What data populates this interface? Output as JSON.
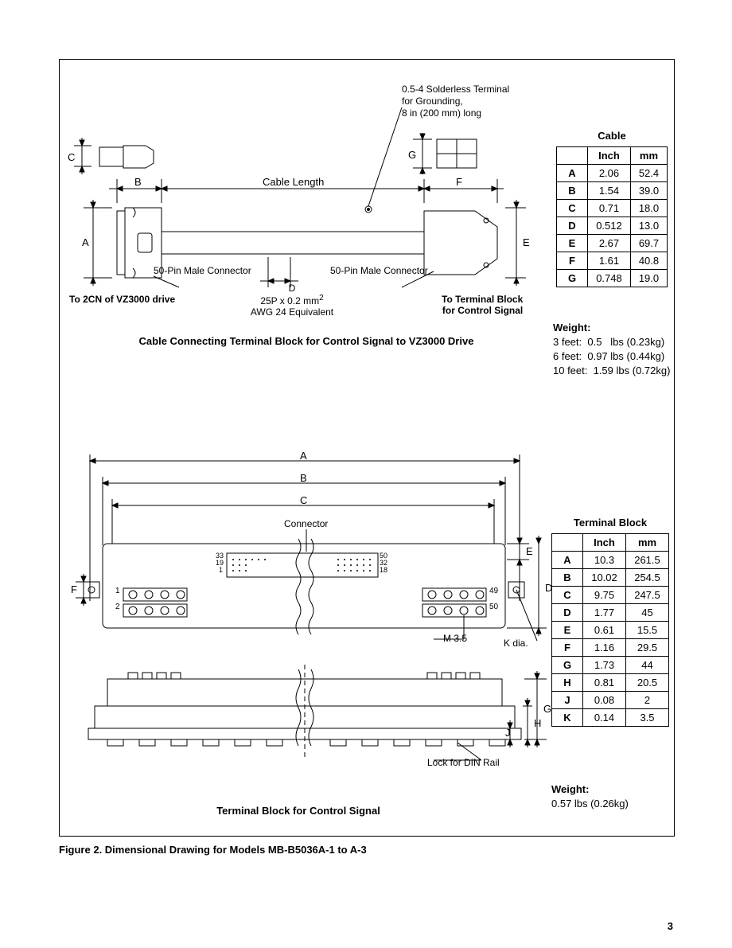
{
  "page_number": "3",
  "figure_caption": "Figure 2.  Dimensional Drawing for Models MB-B5036A-1 to A-3",
  "section1": {
    "solderless_note_l1": "0.5-4 Solderless Terminal",
    "solderless_note_l2": "for Grounding,",
    "solderless_note_l3": "8 in (200 mm) long",
    "lbl_C": "C",
    "lbl_G": "G",
    "lbl_B": "B",
    "lbl_CableLength": "Cable Length",
    "lbl_F": "F",
    "lbl_A": "A",
    "lbl_E": "E",
    "lbl_50pin_left": "50-Pin Male Connector",
    "lbl_50pin_right": "50-Pin Male Connector",
    "lbl_D": "D",
    "lbl_cable_spec_l1": "25P x 0.2 mm",
    "lbl_cable_spec_sup": "2",
    "lbl_cable_spec_l2": "AWG 24 Equivalent",
    "lbl_to2cn": "To 2CN of VZ3000 drive",
    "lbl_to_tb_l1": "To Terminal Block",
    "lbl_to_tb_l2": "for Control Signal",
    "drawing_title": "Cable Connecting Terminal Block for Control Signal to VZ3000 Drive",
    "table_title": "Cable",
    "col_inch": "Inch",
    "col_mm": "mm",
    "rows": [
      {
        "k": "A",
        "in": "2.06",
        "mm": "52.4"
      },
      {
        "k": "B",
        "in": "1.54",
        "mm": "39.0"
      },
      {
        "k": "C",
        "in": "0.71",
        "mm": "18.0"
      },
      {
        "k": "D",
        "in": "0.512",
        "mm": "13.0"
      },
      {
        "k": "E",
        "in": "2.67",
        "mm": "69.7"
      },
      {
        "k": "F",
        "in": "1.61",
        "mm": "40.8"
      },
      {
        "k": "G",
        "in": "0.748",
        "mm": "19.0"
      }
    ],
    "weight_title": "Weight:",
    "weight_l1": "3 feet:  0.5   lbs (0.23kg)",
    "weight_l2": "6 feet:  0.97 lbs (0.44kg)",
    "weight_l3": "10 feet:  1.59 lbs (0.72kg)"
  },
  "section2": {
    "lbl_A": "A",
    "lbl_B": "B",
    "lbl_C": "C",
    "lbl_D": "D",
    "lbl_E": "E",
    "lbl_F": "F",
    "lbl_G": "G",
    "lbl_H": "H",
    "lbl_J": "J",
    "lbl_Kdia": "K dia.",
    "lbl_Connector": "Connector",
    "conn_pin_33": "33",
    "conn_pin_19": "19",
    "conn_pin_1": "1",
    "conn_pin_50": "50",
    "conn_pin_32": "32",
    "conn_pin_18": "18",
    "term_1": "1",
    "term_2": "2",
    "term_49": "49",
    "term_50": "50",
    "lbl_M35": "M 3.5",
    "lbl_lock": "Lock for DIN Rail",
    "drawing_title": "Terminal Block for Control Signal",
    "table_title": "Terminal Block",
    "col_inch": "Inch",
    "col_mm": "mm",
    "rows": [
      {
        "k": "A",
        "in": "10.3",
        "mm": "261.5"
      },
      {
        "k": "B",
        "in": "10.02",
        "mm": "254.5"
      },
      {
        "k": "C",
        "in": "9.75",
        "mm": "247.5"
      },
      {
        "k": "D",
        "in": "1.77",
        "mm": "45"
      },
      {
        "k": "E",
        "in": "0.61",
        "mm": "15.5"
      },
      {
        "k": "F",
        "in": "1.16",
        "mm": "29.5"
      },
      {
        "k": "G",
        "in": "1.73",
        "mm": "44"
      },
      {
        "k": "H",
        "in": "0.81",
        "mm": "20.5"
      },
      {
        "k": "J",
        "in": "0.08",
        "mm": "2"
      },
      {
        "k": "K",
        "in": "0.14",
        "mm": "3.5"
      }
    ],
    "weight_title": "Weight:",
    "weight_l1": "0.57 lbs (0.26kg)"
  }
}
